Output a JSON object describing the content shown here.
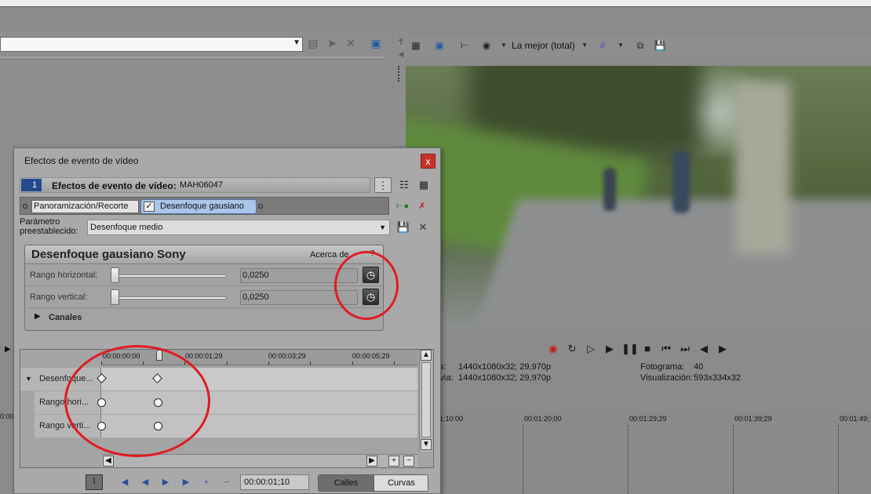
{
  "preview": {
    "quality": "La mejor (total)"
  },
  "properties": {
    "row1_label": "s:",
    "row1_value": "1440x1080x32; 29,970p",
    "row2_label": "vía:",
    "row2_value": "1440x1080x32; 29,970p",
    "frame_label": "Fotograma:",
    "frame_value": "40",
    "view_label": "Visualización:",
    "view_value": "593x334x32"
  },
  "timeline": {
    "ruler": [
      "1:10:00",
      "00:01:20;00",
      "00:01:29;29",
      "00:01:39;29",
      "00:01:49;"
    ],
    "left_ruler": "0:00"
  },
  "dialog": {
    "title": "Efectos de evento de vídeo",
    "close": "x",
    "track_number": "1",
    "header_label": "Efectos de evento de vídeo:",
    "header_value": "MAH06047",
    "chain": [
      "Panoramización/Recorte",
      "Desenfoque gausiano"
    ],
    "preset_label_line1": "Parámetro",
    "preset_label_line2": "preestablecido:",
    "preset_value": "Desenfoque medio",
    "plugin_title": "Desenfoque gausiano Sony",
    "about": "Acerca de",
    "about_help": "?",
    "params": [
      {
        "label": "Rango horizontal:",
        "value": "0,0250"
      },
      {
        "label": "Rango vertical:",
        "value": "0,0250"
      }
    ],
    "channels": "Canales",
    "keyframe_ruler": [
      "00:00:00;00",
      "00:00:01;29",
      "00:00:03;29",
      "00:00:05;29"
    ],
    "keyframe_rows": [
      "Desenfoque...",
      "Rango hori...",
      "Rango verti..."
    ],
    "time_value": "00:00:01;10",
    "seg_lanes": "Calles",
    "seg_curves": "Curvas"
  },
  "icons": {
    "accent_red": "#e11b22",
    "chain_chip_color": "#a9c5e8"
  }
}
